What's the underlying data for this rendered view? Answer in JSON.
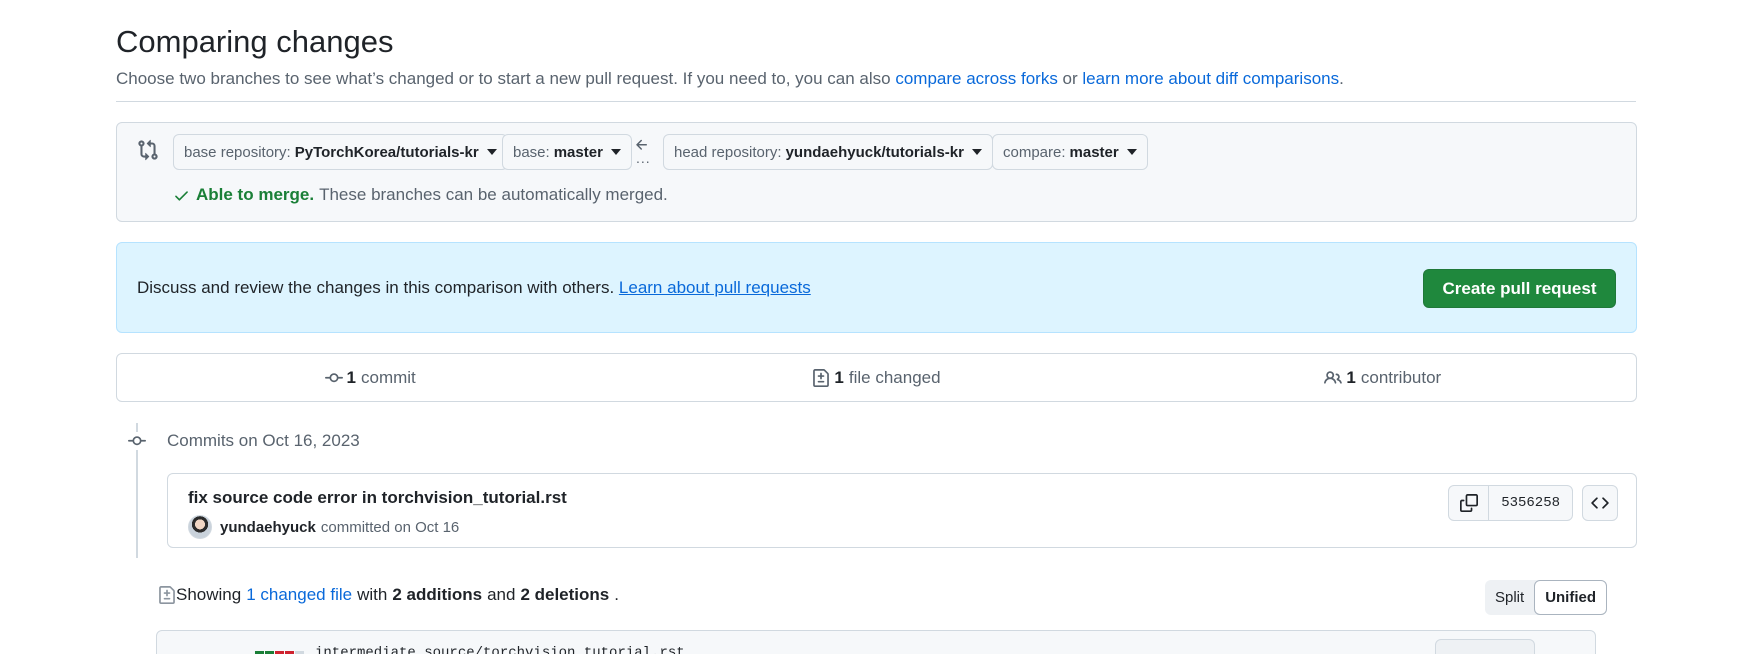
{
  "header": {
    "title": "Comparing changes",
    "description_prefix": "Choose two branches to see what’s changed or to start a new pull request. If you need to, you can also ",
    "link_forks": "compare across forks",
    "description_or": " or ",
    "link_diff": "learn more about diff comparisons",
    "description_suffix": "."
  },
  "range": {
    "base_repo_label": "base repository:",
    "base_repo_value": "PyTorchKorea/tutorials-kr",
    "base_label": "base:",
    "base_value": "master",
    "dots": "...",
    "head_repo_label": "head repository:",
    "head_repo_value": "yundaehyuck/tutorials-kr",
    "compare_label": "compare:",
    "compare_value": "master",
    "merge_ok": "Able to merge.",
    "merge_text": "These branches can be automatically merged."
  },
  "flash": {
    "text": "Discuss and review the changes in this comparison with others. ",
    "link": "Learn about pull requests",
    "button": "Create pull request"
  },
  "summary": {
    "commits_count": "1",
    "commits_label": "commit",
    "files_count": "1",
    "files_label": "file changed",
    "contributors_count": "1",
    "contributors_label": "contributor"
  },
  "commits": {
    "date_heading": "Commits on Oct 16, 2023",
    "items": [
      {
        "title": "fix source code error in torchvision_tutorial.rst",
        "author": "yundaehyuck",
        "meta": "committed on Oct 16",
        "sha": "5356258"
      }
    ]
  },
  "diff": {
    "showing_prefix": "Showing",
    "changed_files_link": "1 changed file",
    "with": "with",
    "additions": "2 additions",
    "and": "and",
    "deletions": "2 deletions",
    "period": ".",
    "view_split": "Split",
    "view_unified": "Unified",
    "file_count": "4",
    "file_path": "intermediate_source/torchvision_tutorial.rst"
  },
  "colors": {
    "accent_link": "#0969da",
    "success": "#1f883d",
    "flash_bg": "#ddf4ff",
    "addition": "#1a7f37",
    "deletion": "#cf222e"
  }
}
